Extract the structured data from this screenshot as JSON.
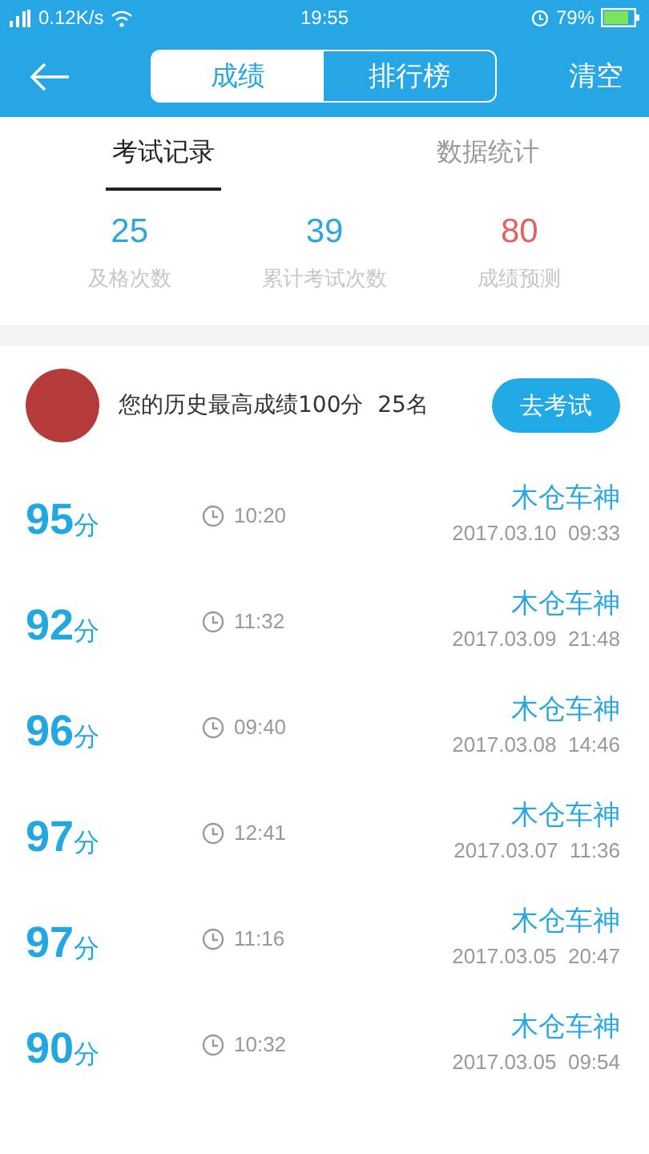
{
  "status_bar": {
    "speed": "0.12K/s",
    "time": "19:55",
    "battery": "79%"
  },
  "header": {
    "tabs": [
      {
        "label": "成绩",
        "selected": true
      },
      {
        "label": "排行榜",
        "selected": false
      }
    ],
    "action": "清空"
  },
  "subtabs": [
    {
      "label": "考试记录",
      "selected": true
    },
    {
      "label": "数据统计",
      "selected": false
    }
  ],
  "stats": [
    {
      "value": "25",
      "label": "及格次数",
      "color": "#2ea6dc"
    },
    {
      "value": "39",
      "label": "累计考试次数",
      "color": "#2ea6dc"
    },
    {
      "value": "80",
      "label": "成绩预测",
      "color": "#e0635e"
    }
  ],
  "best": {
    "text": "您的历史最高成绩100分  25名",
    "button": "去考试"
  },
  "records": [
    {
      "score": "95",
      "unit": "分",
      "duration": "10:20",
      "name": "木仓车神",
      "date": "2017.03.10  09:33"
    },
    {
      "score": "92",
      "unit": "分",
      "duration": "11:32",
      "name": "木仓车神",
      "date": "2017.03.09  21:48"
    },
    {
      "score": "96",
      "unit": "分",
      "duration": "09:40",
      "name": "木仓车神",
      "date": "2017.03.08  14:46"
    },
    {
      "score": "97",
      "unit": "分",
      "duration": "12:41",
      "name": "木仓车神",
      "date": "2017.03.07  11:36"
    },
    {
      "score": "97",
      "unit": "分",
      "duration": "11:16",
      "name": "木仓车神",
      "date": "2017.03.05  20:47"
    },
    {
      "score": "90",
      "unit": "分",
      "duration": "10:32",
      "name": "木仓车神",
      "date": "2017.03.05  09:54"
    }
  ]
}
